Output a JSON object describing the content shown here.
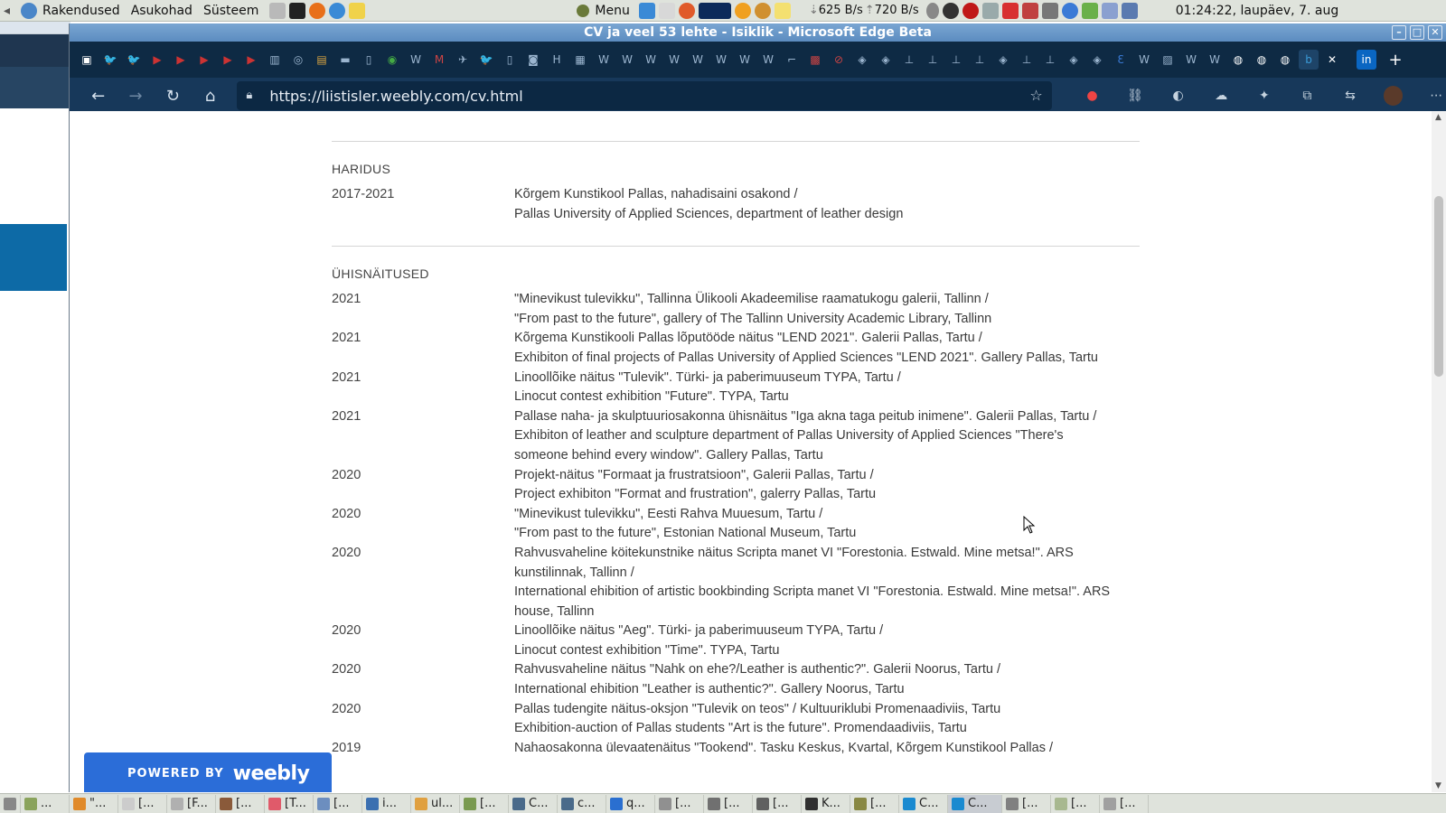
{
  "system_panel": {
    "menus": [
      "Rakendused",
      "Asukohad",
      "Süsteem"
    ],
    "menu_label": "Menu",
    "net_down": "625 B/s",
    "net_up": "720 B/s",
    "clock": "01:24:22, laupäev,  7. aug"
  },
  "window": {
    "title": "CV ja veel 53 lehte - Isiklik - Microsoft Edge Beta",
    "url": "https://liistisler.weebly.com/cv.html"
  },
  "cv": {
    "education": {
      "heading": "HARIDUS",
      "rows": [
        {
          "year": "2017-2021",
          "lines": [
            "Kõrgem Kunstikool Pallas, nahadisaini osakond /",
            "Pallas University of Applied Sciences, department of leather design"
          ]
        }
      ]
    },
    "group_exhibitions": {
      "heading": "ÜHISNÄITUSED",
      "rows": [
        {
          "year": "2021",
          "lines": [
            "\"Minevikust tulevikku\", Tallinna Ülikooli Akadeemilise raamatukogu galerii, Tallinn /",
            "\"From past to the future\", gallery of The Tallinn University Academic Library, Tallinn"
          ]
        },
        {
          "year": "2021",
          "lines": [
            "Kõrgema Kunstikooli Pallas lõputööde näitus \"LEND 2021\". Galerii Pallas, Tartu /",
            "Exhibiton of final projects of Pallas University of Applied Sciences \"LEND 2021\". Gallery Pallas, Tartu"
          ]
        },
        {
          "year": "2021",
          "lines": [
            "Linoollõike näitus \"Tulevik\". Türki- ja paberimuuseum TYPA, Tartu /",
            "Linocut contest exhibition \"Future\". TYPA, Tartu"
          ]
        },
        {
          "year": "2021",
          "lines": [
            "Pallase naha- ja skulptuuriosakonna ühisnäitus \"Iga akna taga peitub inimene\". Galerii Pallas, Tartu /",
            "Exhibiton of leather and sculpture department of Pallas University of Applied Sciences \"There's",
            "someone behind every window\". Gallery Pallas, Tartu"
          ]
        },
        {
          "year": "2020",
          "lines": [
            "Projekt-näitus \"Formaat ja frustratsioon\", Galerii Pallas, Tartu /",
            "Project exhibiton \"Format and frustration\", galerry Pallas, Tartu"
          ]
        },
        {
          "year": "2020",
          "lines": [
            "\"Minevikust tulevikku\", Eesti Rahva Muuesum, Tartu /",
            "\"From past to the future\", Estonian National Museum, Tartu"
          ]
        },
        {
          "year": "2020",
          "lines": [
            "Rahvusvaheline köitekunstnike näitus Scripta manet VI \"Forestonia. Estwald. Mine metsa!\". ARS",
            "kunstilinnak, Tallinn /",
            "International ehibition of artistic bookbinding Scripta manet VI \"Forestonia. Estwald. Mine metsa!\". ARS",
            "house, Tallinn"
          ]
        },
        {
          "year": "2020",
          "lines": [
            "Linoollõike näitus \"Aeg\". Türki- ja paberimuuseum TYPA, Tartu /",
            "Linocut contest exhibition \"Time\". TYPA, Tartu"
          ]
        },
        {
          "year": "2020",
          "lines": [
            "Rahvusvaheline näitus \"Nahk on ehe?/Leather is authentic?\". Galerii Noorus, Tartu /",
            "International ehibition \"Leather is authentic?\". Gallery Noorus, Tartu"
          ]
        },
        {
          "year": "2020",
          "lines": [
            "Pallas tudengite näitus-oksjon \"Tulevik on teos\" / Kultuuriklubi Promenaadiviis, Tartu",
            "Exhibition-auction of Pallas students \"Art is the future\". Promendaadiviis, Tartu"
          ]
        },
        {
          "year": "2019",
          "lines": [
            "Nahaosakonna ülevaatenäitus \"Tookend\". Tasku Keskus, Kvartal, Kõrgem Kunstikool Pallas /"
          ]
        }
      ]
    }
  },
  "weebly_badge": {
    "powered": "POWERED BY",
    "brand": "weebly"
  },
  "taskbar": [
    {
      "label": "...",
      "color": "#8aa35c"
    },
    {
      "label": "\"...",
      "color": "#e08a2a"
    },
    {
      "label": "[...",
      "color": "#cccccc"
    },
    {
      "label": "[F...",
      "color": "#b0b0b0"
    },
    {
      "label": "[...",
      "color": "#8a5a3a"
    },
    {
      "label": "[T...",
      "color": "#e05a6a"
    },
    {
      "label": "[...",
      "color": "#6c8ebf"
    },
    {
      "label": "i...",
      "color": "#3b6fb0"
    },
    {
      "label": "ul...",
      "color": "#e0a040"
    },
    {
      "label": "[...",
      "color": "#7a9a50"
    },
    {
      "label": "C...",
      "color": "#4a6a8a"
    },
    {
      "label": "c...",
      "color": "#4a6a8a"
    },
    {
      "label": "q...",
      "color": "#2a6fd0"
    },
    {
      "label": "[...",
      "color": "#909090"
    },
    {
      "label": "[...",
      "color": "#707070"
    },
    {
      "label": "[...",
      "color": "#606060"
    },
    {
      "label": "K...",
      "color": "#303030"
    },
    {
      "label": "[...",
      "color": "#888844"
    },
    {
      "label": "C...",
      "color": "#1a8ad0"
    },
    {
      "label": "C...",
      "color": "#1a8ad0"
    },
    {
      "label": "[...",
      "color": "#808080"
    },
    {
      "label": "[...",
      "color": "#a8b890"
    },
    {
      "label": "[...",
      "color": "#a0a0a0"
    }
  ],
  "colors": {
    "accent": "#2b6dd8",
    "edge_dark": "#17385a"
  }
}
